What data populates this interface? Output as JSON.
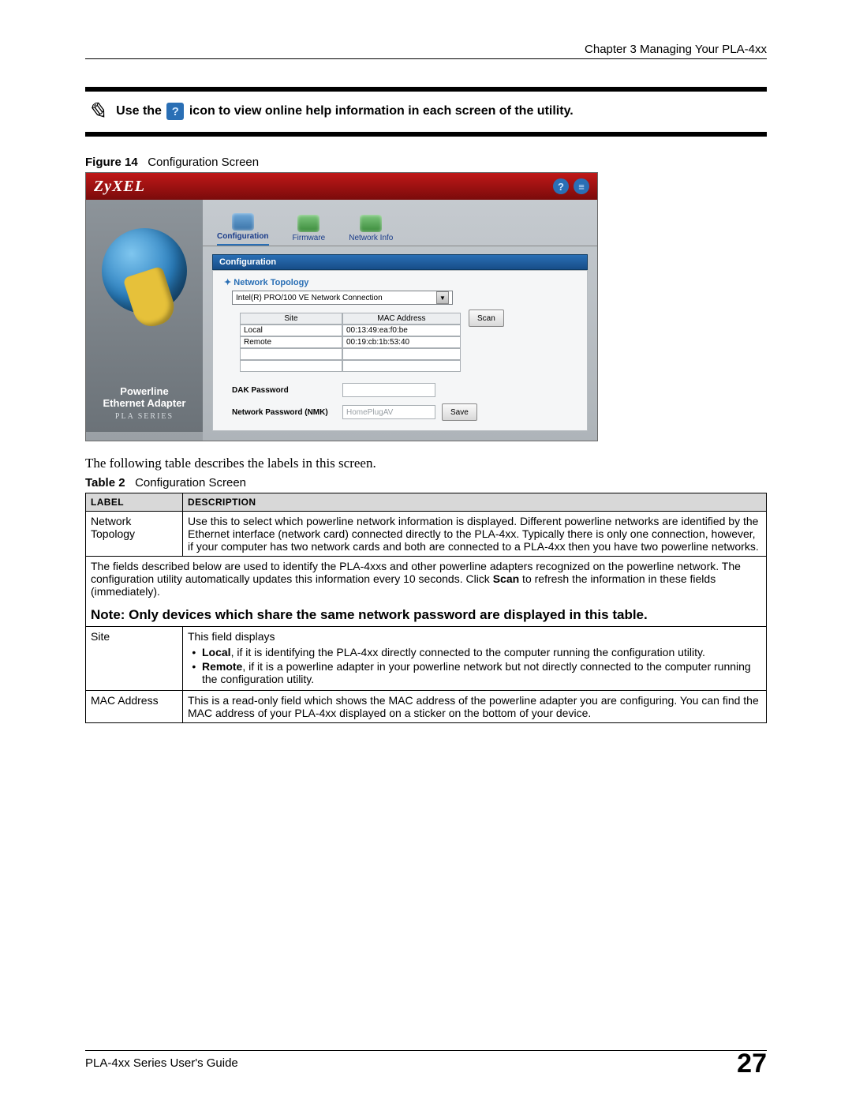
{
  "header": {
    "chapter": "Chapter 3 Managing Your PLA-4xx"
  },
  "callout": {
    "pre": "Use the ",
    "post": " icon to view online help information in each screen of the utility.",
    "help_glyph": "?"
  },
  "figure": {
    "label": "Figure 14",
    "title": "Configuration Screen"
  },
  "utility": {
    "brand": "ZyXEL",
    "top_help": "?",
    "tabs": [
      "Configuration",
      "Firmware",
      "Network Info"
    ],
    "section": "Configuration",
    "panel_header": "Network Topology",
    "connection": "Intel(R) PRO/100 VE Network Connection",
    "grid_headers": [
      "Site",
      "MAC Address"
    ],
    "grid_rows": [
      {
        "site": "Local",
        "mac": "00:13:49:ea:f0:be"
      },
      {
        "site": "Remote",
        "mac": "00:19:cb:1b:53:40"
      }
    ],
    "scan_btn": "Scan",
    "dak_label": "DAK Password",
    "nmk_label": "Network Password (NMK)",
    "nmk_value": "HomePlugAV",
    "save_btn": "Save",
    "side": {
      "l1": "Powerline",
      "l2": "Ethernet Adapter",
      "l3": "PLA SERIES"
    }
  },
  "para": "The following table describes the labels in this screen.",
  "table_caption": {
    "label": "Table 2",
    "title": "Configuration Screen"
  },
  "table": {
    "head": [
      "LABEL",
      "DESCRIPTION"
    ],
    "r1": {
      "label": "Network Topology",
      "desc": "Use this to select which powerline network information is displayed. Different powerline networks are identified by the Ethernet interface (network card) connected directly to the PLA-4xx. Typically there is only one connection, however, if your computer has two network cards and both are connected to a PLA-4xx then you have two powerline networks."
    },
    "span": {
      "p": "The fields described below are used to identify the PLA-4xxs and other powerline adapters recognized on the powerline network. The configuration utility automatically updates this information every 10 seconds. Click ",
      "b": "Scan",
      "p2": " to refresh the information in these fields (immediately).",
      "note": "Note: Only devices which share the same network password are displayed in this table."
    },
    "r2": {
      "label": "Site",
      "intro": "This field displays",
      "b1a": "Local",
      "b1b": ", if it is identifying the PLA-4xx directly connected to the computer running the configuration utility.",
      "b2a": "Remote",
      "b2b": ", if it is a powerline adapter in your powerline network but not directly connected to the computer running the configuration utility."
    },
    "r3": {
      "label": "MAC Address",
      "desc": "This is a read-only field which shows the MAC address of the powerline adapter you are configuring. You can find the MAC address of your PLA-4xx displayed on a sticker on the bottom of your device."
    }
  },
  "footer": {
    "guide": "PLA-4xx Series User's Guide",
    "page": "27"
  }
}
